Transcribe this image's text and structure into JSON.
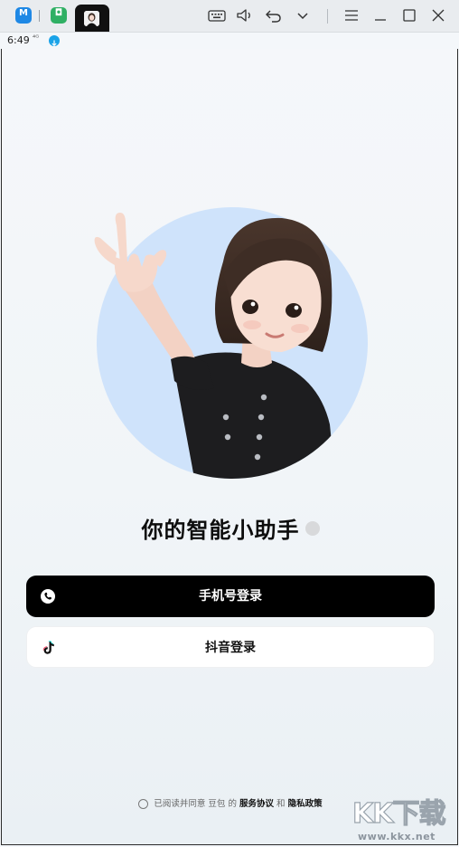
{
  "titlebar": {
    "apps": [
      {
        "name": "app-1",
        "glyph": "M"
      },
      {
        "name": "app-2",
        "glyph": "◘"
      }
    ],
    "icons": [
      "keyboard-icon",
      "volume-icon",
      "undo-icon",
      "chevron-down-icon",
      "menu-icon",
      "minimize-icon",
      "maximize-icon",
      "close-icon"
    ]
  },
  "statusbar": {
    "time": "6:49",
    "net": "⁴ᴳ"
  },
  "main": {
    "slogan": "你的智能小助手",
    "phone_login_label": "手机号登录",
    "douyin_login_label": "抖音登录",
    "agreement": {
      "prefix": "已阅读并同意 豆包 的",
      "service": "服务协议",
      "and": "和",
      "privacy": "隐私政策"
    }
  },
  "watermark": {
    "big": "KK下载",
    "small": "www.kkx.net"
  },
  "colors": {
    "primary_button": "#000000",
    "secondary_button": "#ffffff",
    "avatar_circle": "#cfe3fb",
    "background": "#f3f6f9"
  }
}
